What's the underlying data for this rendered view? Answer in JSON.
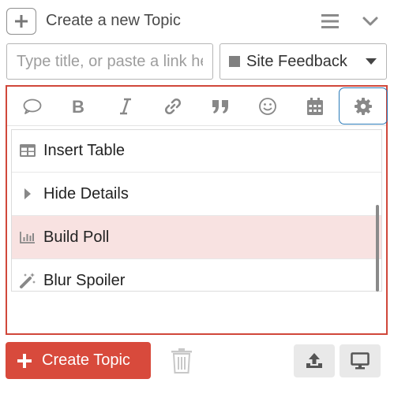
{
  "header": {
    "title": "Create a new Topic",
    "icons": {
      "new": "plus-icon",
      "menu": "hamburger-icon",
      "collapse": "chevron-down-icon"
    }
  },
  "title_input": {
    "placeholder": "Type title, or paste a link here",
    "value": ""
  },
  "category": {
    "label": "Site Feedback",
    "swatch_color": "#808080",
    "icon": "caret-down-icon"
  },
  "toolbar": {
    "buttons": [
      {
        "name": "quote-bubble-icon"
      },
      {
        "name": "bold-icon"
      },
      {
        "name": "italic-icon"
      },
      {
        "name": "link-icon"
      },
      {
        "name": "blockquote-icon"
      },
      {
        "name": "emoji-icon"
      },
      {
        "name": "calendar-icon"
      },
      {
        "name": "gear-icon",
        "active": true
      }
    ]
  },
  "menu": {
    "items": [
      {
        "label": "Insert Table",
        "icon": "table-icon"
      },
      {
        "label": "Hide Details",
        "icon": "caret-right-icon"
      },
      {
        "label": "Build Poll",
        "icon": "bar-chart-icon",
        "highlighted": true
      },
      {
        "label": "Blur Spoiler",
        "icon": "magic-wand-icon"
      }
    ]
  },
  "footer": {
    "create_label": "Create Topic",
    "icons": {
      "discard": "trash-icon",
      "upload": "upload-icon",
      "preview": "desktop-icon"
    }
  },
  "colors": {
    "accent": "#d84a3c",
    "editor_border": "#d0473a",
    "active_button_border": "#2a7ab8",
    "highlight_row": "#f8e2e1",
    "icon_gray": "#8a8a8a"
  }
}
